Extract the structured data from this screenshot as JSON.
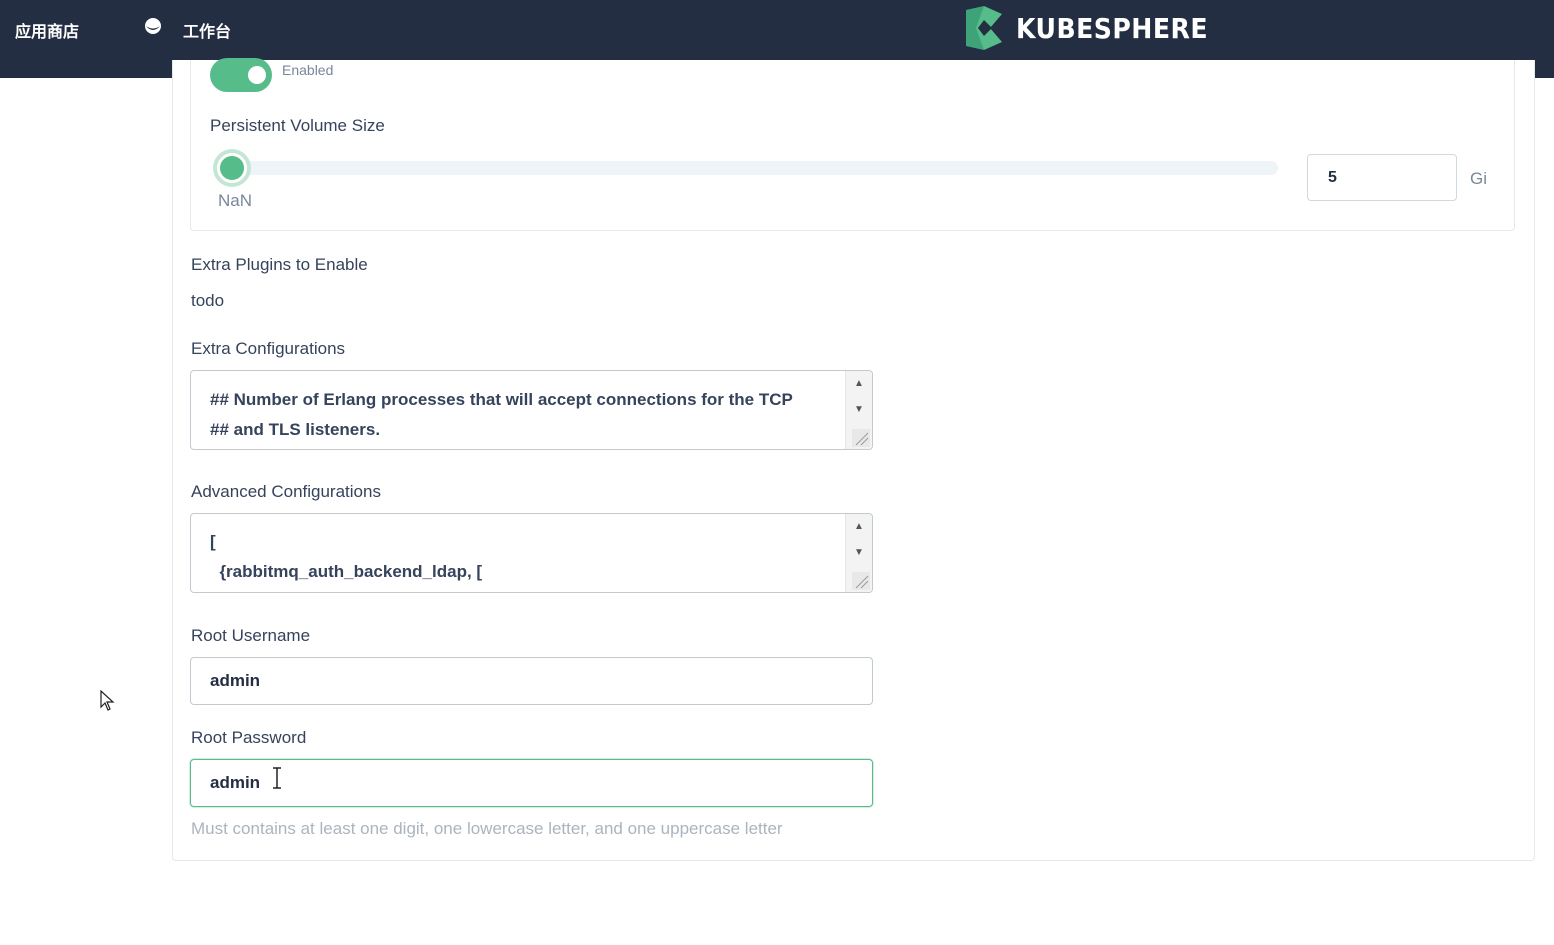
{
  "topbar": {
    "app_store": "应用商店",
    "workbench": "工作台",
    "logo_text": "KUBESPHERE",
    "colors": {
      "background": "#242e42",
      "logo_green": "#55bc8a"
    }
  },
  "persistence": {
    "toggle_label": "Enabled",
    "toggle_on": true,
    "volume_size_label": "Persistent Volume Size",
    "slider_mark": "NaN",
    "slider_value_fraction": 0,
    "size_value": "5",
    "size_unit": "Gi"
  },
  "extra_plugins": {
    "label": "Extra Plugins to Enable",
    "value": "todo"
  },
  "extra_configurations": {
    "label": "Extra Configurations",
    "lines": [
      "## Number of Erlang processes that will accept connections for the TCP",
      "## and TLS listeners."
    ]
  },
  "advanced_configurations": {
    "label": "Advanced Configurations",
    "lines": [
      "[",
      "  {rabbitmq_auth_backend_ldap, ["
    ]
  },
  "root_username": {
    "label": "Root Username",
    "value": "admin"
  },
  "root_password": {
    "label": "Root Password",
    "value": "admin",
    "hint": "Must contains at least one digit, one lowercase letter, and one uppercase letter"
  },
  "icons": {
    "globe": "globe-icon",
    "logo": "kubesphere-logo-icon",
    "text_cursor": "ibeam-cursor-icon",
    "mouse_pointer": "mouse-pointer-icon"
  }
}
